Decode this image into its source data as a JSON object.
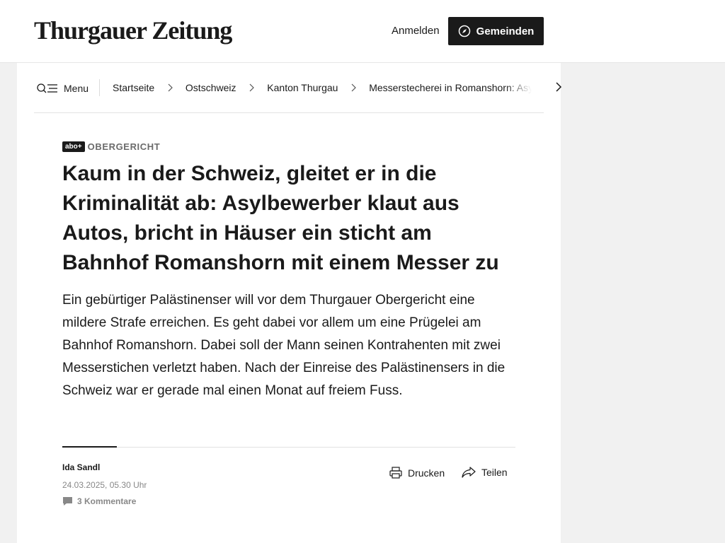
{
  "header": {
    "logo": "Thurgauer Zeitung",
    "login_label": "Anmelden",
    "gemeinden_label": "Gemeinden",
    "gemeinden_icon": "compass-icon"
  },
  "breadcrumb": {
    "menu_label": "Menu",
    "items": [
      "Startseite",
      "Ostschweiz",
      "Kanton Thurgau",
      "Messerstecherei in Romanshorn: Asylbewerber"
    ]
  },
  "article": {
    "badge": "abo+",
    "kicker": "OBERGERICHT",
    "headline": "Kaum in der Schweiz, gleitet er in die Kriminalität ab: Asylbewerber klaut aus Autos, bricht in Häuser ein sticht am Bahnhof Romanshorn mit einem Messer zu",
    "lead": "Ein gebürtiger Palästinenser will vor dem Thurgauer Obergericht eine mildere Strafe erreichen. Es geht dabei vor allem um eine Prügelei am Bahnhof Romanshorn. Dabei soll der Mann seinen Kontrahenten mit zwei Messerstichen verletzt haben. Nach der Einreise des Palästinensers in die Schweiz war er gerade mal einen Monat auf freiem Fuss.",
    "author": "Ida Sandl",
    "date": "24.03.2025, 05.30 Uhr",
    "comments": "3 Kommentare",
    "print_label": "Drucken",
    "share_label": "Teilen"
  },
  "colors": {
    "text": "#1a1a1a",
    "meta_gray": "#888888",
    "page_bg": "#f1f1f1",
    "button_bg": "#1a1a1a"
  }
}
